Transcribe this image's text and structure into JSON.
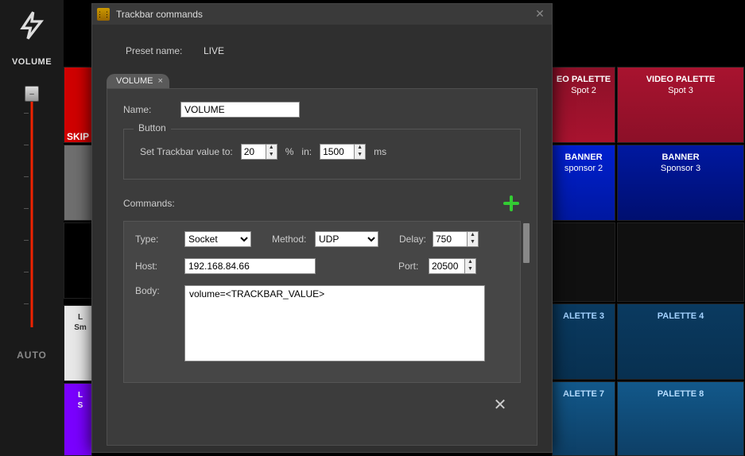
{
  "sidebar": {
    "volume_label": "VOLUME",
    "auto_label": "AUTO",
    "slider_thumb_glyph": "–"
  },
  "left_tiles": {
    "skip": "SKIP",
    "white1_a": "L",
    "white1_b": "Sm",
    "purple_a": "L",
    "purple_b": "S"
  },
  "grid": {
    "r0c2_a": "EO PALETTE",
    "r0c2_b": "Spot 2",
    "r0c3_a": "VIDEO PALETTE",
    "r0c3_b": "Spot 3",
    "r1c2_a": "BANNER",
    "r1c2_b": "sponsor 2",
    "r1c3_a": "BANNER",
    "r1c3_b": "Sponsor 3",
    "r3c2": "ALETTE 3",
    "r3c3": "PALETTE 4",
    "r4c2": "ALETTE 7",
    "r4c3": "PALETTE 8"
  },
  "dialog": {
    "title": "Trackbar commands",
    "preset_label": "Preset name:",
    "preset_value": "LIVE",
    "tab_label": "VOLUME",
    "name_label": "Name:",
    "name_value": "VOLUME",
    "button_fieldset": {
      "legend": "Button",
      "set_label": "Set Trackbar value to:",
      "value": "20",
      "pct": "%",
      "in": "in:",
      "ms_value": "1500",
      "ms": "ms"
    },
    "commands_label": "Commands:",
    "cmd": {
      "type_label": "Type:",
      "type_value": "Socket",
      "method_label": "Method:",
      "method_value": "UDP",
      "delay_label": "Delay:",
      "delay_value": "750",
      "host_label": "Host:",
      "host_value": "192.168.84.66",
      "port_label": "Port:",
      "port_value": "20500",
      "body_label": "Body:",
      "body_value": "volume=<TRACKBAR_VALUE>"
    }
  }
}
